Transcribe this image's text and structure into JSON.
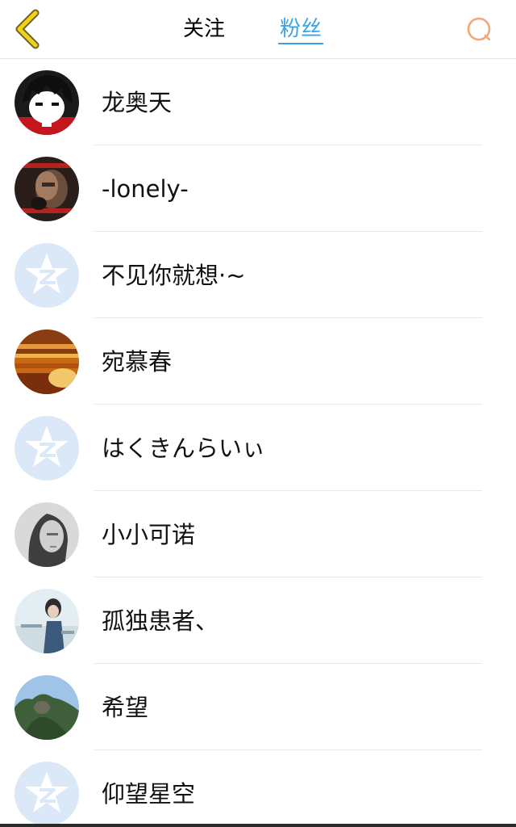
{
  "header": {
    "tabs": [
      {
        "label": "关注",
        "active": false
      },
      {
        "label": "粉丝",
        "active": true
      }
    ],
    "accent_color": "#3aa4e6",
    "back_icon": "chevron-left-icon",
    "search_icon": "search-icon"
  },
  "fans": [
    {
      "name": "龙奥天",
      "avatar": "cartoon-avatar"
    },
    {
      "name": "-lonely-",
      "avatar": "photo-avatar"
    },
    {
      "name": "不见你就想·~",
      "avatar": "default-qzone-avatar"
    },
    {
      "name": "宛慕春",
      "avatar": "photo-avatar"
    },
    {
      "name": "はくきんらいぃ",
      "avatar": "default-qzone-avatar"
    },
    {
      "name": "小小可诺",
      "avatar": "photo-avatar"
    },
    {
      "name": "孤独患者、",
      "avatar": "photo-avatar"
    },
    {
      "name": "希望",
      "avatar": "photo-avatar"
    },
    {
      "name": "仰望星空",
      "avatar": "default-qzone-avatar"
    }
  ]
}
